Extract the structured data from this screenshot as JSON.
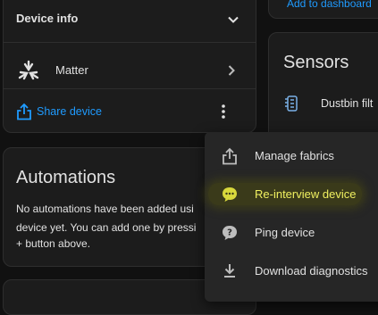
{
  "device_info": {
    "title": "Device info",
    "matter_label": "Matter",
    "share_label": "Share device"
  },
  "top_right": {
    "link_label": "Add to dashboard"
  },
  "sensors": {
    "title": "Sensors",
    "item_label": "Dustbin filt"
  },
  "automations": {
    "title": "Automations",
    "body_line1": "No automations have been added usi",
    "body_line2": "device yet. You can add one by pressi",
    "body_line3": "+ button above."
  },
  "menu": {
    "items": [
      {
        "label": "Manage fabrics",
        "icon": "share-icon"
      },
      {
        "label": "Re-interview device",
        "icon": "chat-bubble-icon"
      },
      {
        "label": "Ping device",
        "icon": "help-bubble-icon"
      },
      {
        "label": "Download diagnostics",
        "icon": "download-icon"
      }
    ]
  },
  "colors": {
    "accent": "#1f9bff",
    "highlight_text": "#f0f060",
    "highlight_glow": "#3a3a1a",
    "card_bg": "#1c1c1c",
    "page_bg": "#111111",
    "menu_bg": "#262626"
  }
}
